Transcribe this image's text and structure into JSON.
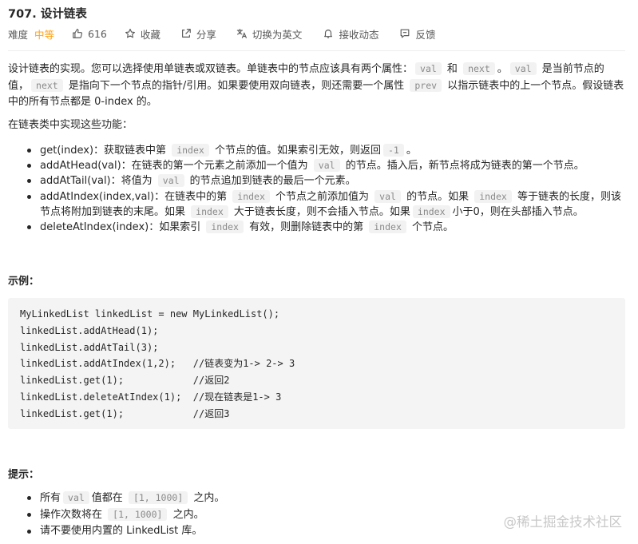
{
  "problem": {
    "title": "707. 设计链表",
    "difficulty_label": "难度",
    "difficulty_value": "中等",
    "difficulty_color": "#ffa116"
  },
  "meta": {
    "likes": "616",
    "favorite": "收藏",
    "share": "分享",
    "translate": "切换为英文",
    "dynamic": "接收动态",
    "feedback": "反馈"
  },
  "description": {
    "p1": [
      "设计链表的实现。您可以选择使用单链表或双链表。单链表中的节点应该具有两个属性：",
      "val",
      " 和 ",
      "next",
      "。",
      "val",
      " 是当前节点的值，",
      "next",
      " 是指向下一个节点的指针/引用。如果要使用双向链表，则还需要一个属性 ",
      "prev",
      " 以指示链表中的上一个节点。假设链表中的所有节点都是 0-index 的。"
    ],
    "p2": "在链表类中实现这些功能：",
    "features": [
      [
        "get(index)：获取链表中第 ",
        "index",
        " 个节点的值。如果索引无效，则返回",
        "-1",
        "。"
      ],
      [
        "addAtHead(val)：在链表的第一个元素之前添加一个值为 ",
        "val",
        " 的节点。插入后，新节点将成为链表的第一个节点。"
      ],
      [
        "addAtTail(val)：将值为 ",
        "val",
        " 的节点追加到链表的最后一个元素。"
      ],
      [
        "addAtIndex(index,val)：在链表中的第 ",
        "index",
        " 个节点之前添加值为 ",
        "val",
        " 的节点。如果 ",
        "index",
        " 等于链表的长度，则该节点将附加到链表的末尾。如果 ",
        "index",
        " 大于链表长度，则不会插入节点。如果",
        "index",
        "小于0，则在头部插入节点。"
      ],
      [
        "deleteAtIndex(index)：如果索引 ",
        "index",
        " 有效，则删除链表中的第 ",
        "index",
        " 个节点。"
      ]
    ]
  },
  "example": {
    "heading": "示例：",
    "code_lines": [
      "MyLinkedList linkedList = new MyLinkedList();",
      "linkedList.addAtHead(1);",
      "linkedList.addAtTail(3);",
      "linkedList.addAtIndex(1,2);   //链表变为1-> 2-> 3",
      "linkedList.get(1);            //返回2",
      "linkedList.deleteAtIndex(1);  //现在链表是1-> 3",
      "linkedList.get(1);            //返回3"
    ]
  },
  "hints": {
    "heading": "提示：",
    "items": [
      [
        "所有",
        "val",
        "值都在 ",
        "[1, 1000]",
        " 之内。"
      ],
      [
        "操作次数将在 ",
        "[1, 1000]",
        " 之内。"
      ],
      [
        "请不要使用内置的 LinkedList 库。"
      ]
    ]
  },
  "watermark": "@稀土掘金技术社区",
  "icons": {
    "like": "thumbs-up-icon",
    "favorite": "star-icon",
    "share": "share-icon",
    "translate": "translate-icon",
    "dynamic": "bell-icon",
    "feedback": "feedback-icon"
  }
}
